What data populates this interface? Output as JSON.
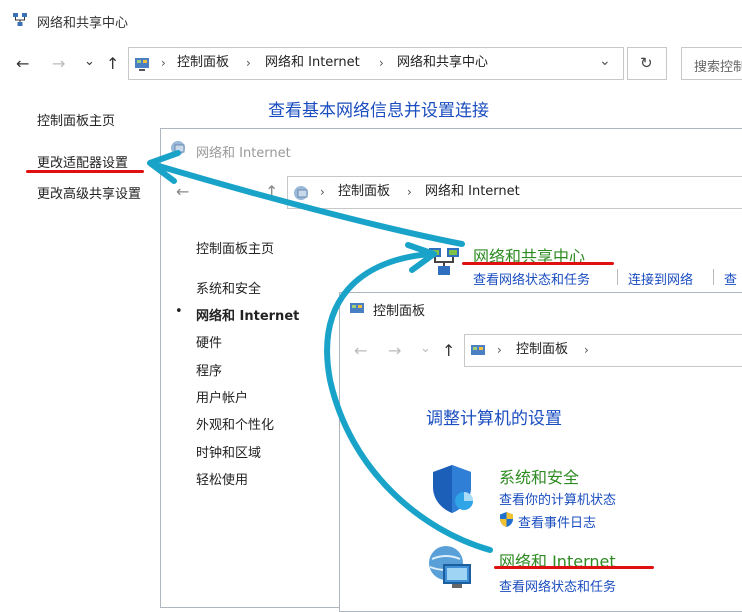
{
  "outer": {
    "title": "网络和共享中心",
    "breadcrumb": [
      "控制面板",
      "网络和 Internet",
      "网络和共享中心"
    ],
    "search_placeholder": "搜索控制",
    "sidebar": [
      "控制面板主页",
      "更改适配器设置",
      "更改高级共享设置"
    ],
    "heading": "查看基本网络信息并设置连接"
  },
  "middle": {
    "title": "网络和 Internet",
    "breadcrumb": [
      "控制面板",
      "网络和 Internet"
    ],
    "sidebar_home": "控制面板主页",
    "sidebar": [
      "系统和安全",
      "网络和 Internet",
      "硬件",
      "程序",
      "用户帐户",
      "外观和个性化",
      "时钟和区域",
      "轻松使用"
    ],
    "section_title": "网络和共享中心",
    "section_links": [
      "查看网络状态和任务",
      "连接到网络",
      "查"
    ]
  },
  "inner": {
    "title": "控制面板",
    "breadcrumb": [
      "控制面板"
    ],
    "heading": "调整计算机的设置",
    "categories": [
      {
        "title": "系统和安全",
        "links": [
          "查看你的计算机状态",
          "查看事件日志"
        ]
      },
      {
        "title": "网络和 Internet",
        "links": [
          "查看网络状态和任务"
        ]
      }
    ]
  },
  "icons": {
    "back": "←",
    "forward": "→",
    "down": "⌄",
    "up": "↑",
    "refresh": "↻",
    "chevron": "›",
    "bullet": "•"
  },
  "colors": {
    "link": "#1a4dbf",
    "category": "#2e8b22",
    "underline": "#e01010",
    "arrow": "#1aa3c9"
  }
}
